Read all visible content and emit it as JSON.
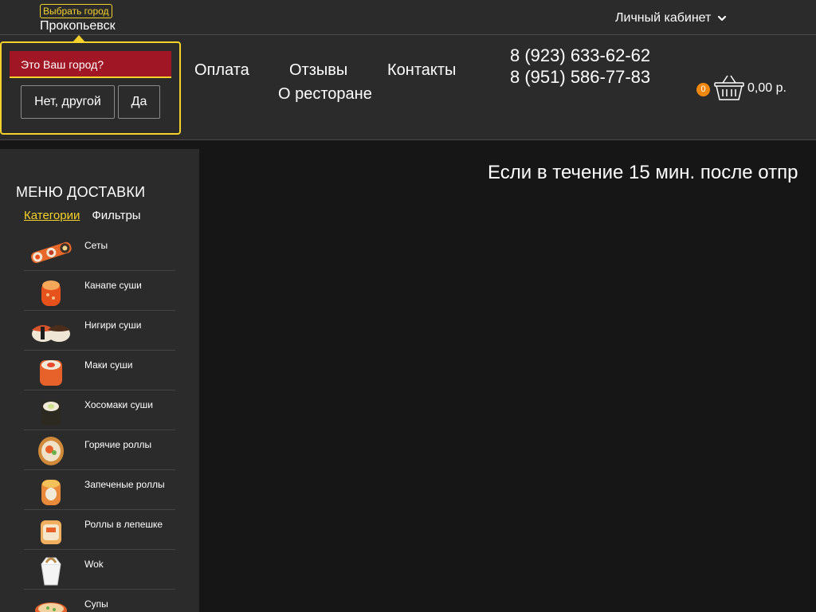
{
  "topbar": {
    "city_choose_label": "Выбрать город",
    "city_name": "Прокопьевск",
    "account_label": "Личный кабинет"
  },
  "nav": {
    "payment": "Оплата",
    "reviews": "Отзывы",
    "contacts": "Контакты",
    "about": "О ресторане"
  },
  "phones": [
    "8 (923) 633-62-62",
    "8 (951) 586-77-83"
  ],
  "cart": {
    "count": "0",
    "total": "0,00 р."
  },
  "city_popup": {
    "question": "Это Ваш город?",
    "no_label": "Нет, другой",
    "yes_label": "Да"
  },
  "sidebar": {
    "title": "МЕНЮ ДОСТАВКИ",
    "tab_categories": "Категории",
    "tab_filters": "Фильтры",
    "categories": [
      {
        "label": "Сеты",
        "icon": "sets-image"
      },
      {
        "label": "Канапе суши",
        "icon": "canape-sushi-image"
      },
      {
        "label": "Нигири суши",
        "icon": "nigiri-sushi-image"
      },
      {
        "label": "Маки суши",
        "icon": "maki-sushi-image"
      },
      {
        "label": "Хосомаки суши",
        "icon": "hosomaki-sushi-image"
      },
      {
        "label": "Горячие роллы",
        "icon": "hot-rolls-image"
      },
      {
        "label": "Запеченые роллы",
        "icon": "baked-rolls-image"
      },
      {
        "label": "Роллы в лепешке",
        "icon": "flatbread-rolls-image"
      },
      {
        "label": "Wok",
        "icon": "wok-image"
      },
      {
        "label": "Супы",
        "icon": "soups-image"
      }
    ]
  },
  "main": {
    "marquee_text": "Если в течение 15 мин. после отпр"
  },
  "colors": {
    "accent_yellow": "#f5d22b",
    "popup_red": "#a01625",
    "badge_orange": "#f0880e",
    "panel_bg": "#2b2b2b",
    "page_bg": "#161616"
  }
}
